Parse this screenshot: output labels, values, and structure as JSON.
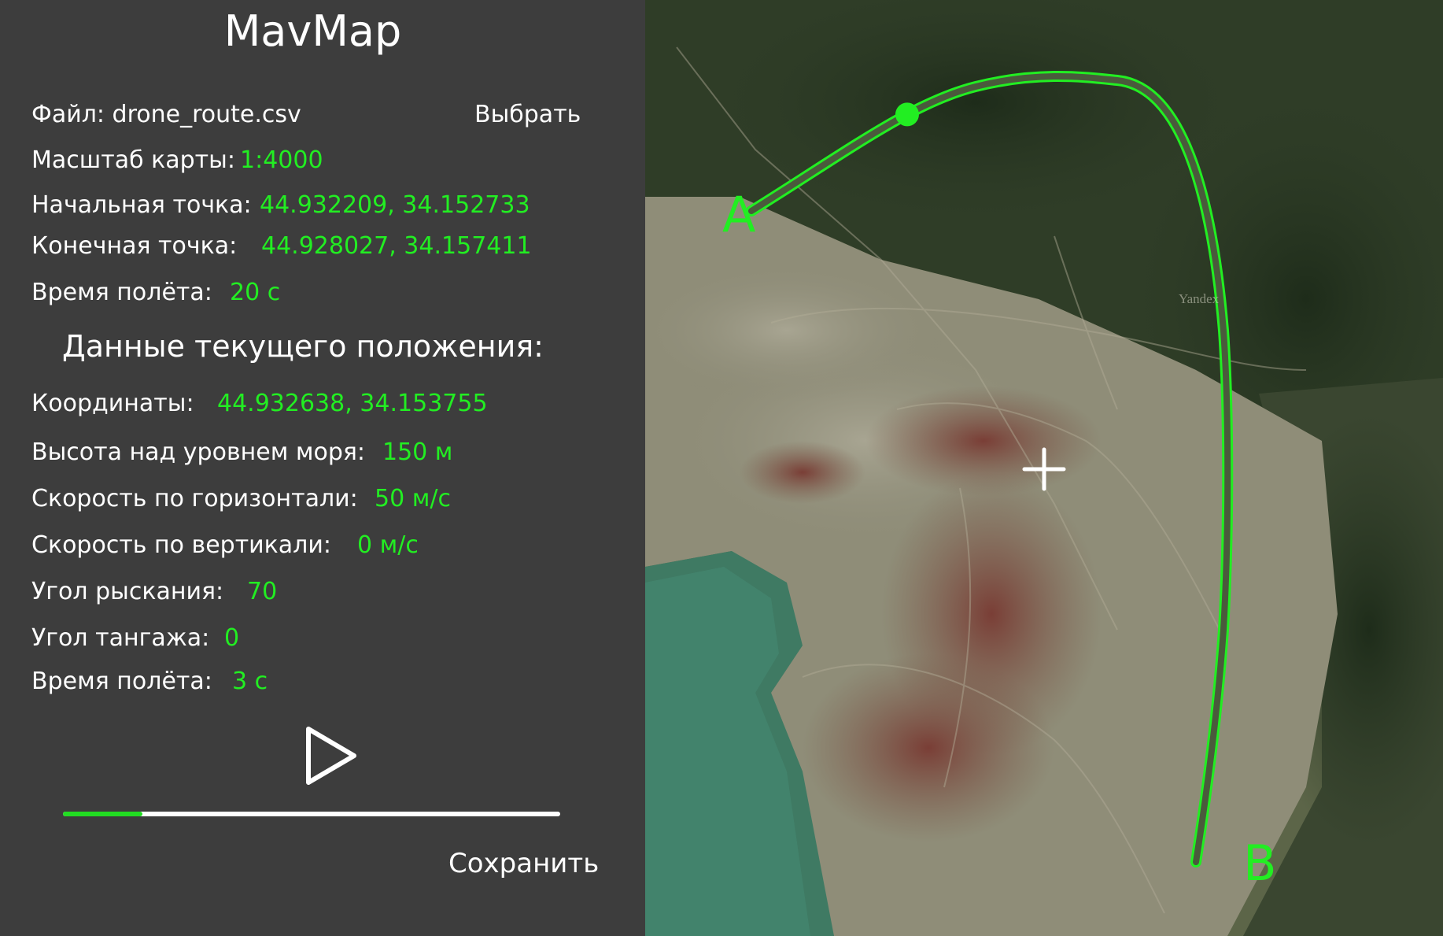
{
  "app": {
    "title": "MavMap"
  },
  "file": {
    "label": "Файл: drone_route.csv",
    "pick_label": "Выбрать"
  },
  "route_info": {
    "scale_label": "Масштаб карты:",
    "scale_value": "1:4000",
    "start_label": "Начальная точка:",
    "start_value": "44.932209, 34.152733",
    "end_label": "Конечная точка:",
    "end_value": "44.928027, 34.157411",
    "time_label": "Время полёта:",
    "time_value": "20 с"
  },
  "current": {
    "section_title": "Данные текущего положения:",
    "coords_label": "Координаты:",
    "coords_value": "44.932638, 34.153755",
    "altitude_label": "Высота над уровнем моря:",
    "altitude_value": "150 м",
    "hspeed_label": "Скорость по горизонтали:",
    "hspeed_value": "50 м/с",
    "vspeed_label": "Скорость по вертикали:",
    "vspeed_value": "0 м/с",
    "yaw_label": "Угол рыскания:",
    "yaw_value": "70",
    "pitch_label": "Угол тангажа:",
    "pitch_value": "0",
    "time_label": "Время полёта:",
    "time_value": "3 с"
  },
  "player": {
    "play_icon": "play-icon",
    "progress_fraction": 0.16,
    "save_label": "Сохранить"
  },
  "map": {
    "label_a": "A",
    "label_b": "B",
    "watermark": "Yandex",
    "marker_fraction": 0.15,
    "route_color": "#22ee22",
    "crosshair_icon": "crosshair-icon"
  },
  "colors": {
    "panel_bg": "#3d3d3d",
    "accent": "#22ee22",
    "text": "#ffffff"
  }
}
